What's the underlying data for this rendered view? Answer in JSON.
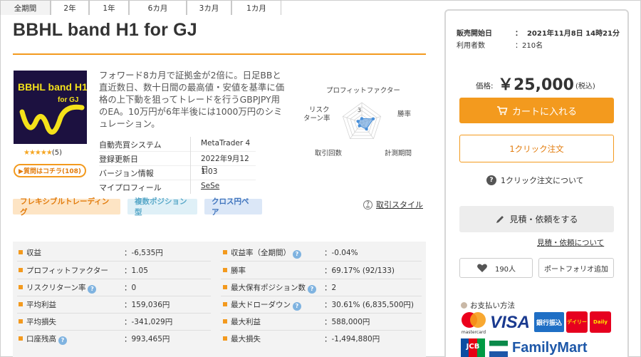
{
  "product": {
    "title": "BBHL band H1 for GJ",
    "logo_text_line1": "BBHL band H1",
    "logo_text_line2": "for GJ",
    "rating_stars": "★★★★★",
    "rating_count": "(5)",
    "rating_value": 5,
    "qa_button": "▶質問はコチラ(108)",
    "description": "フォワード8カ月で証拠金が2倍に。日足BBと直近数日、数十日間の最高値・安値を基準に価格の上下動を狙ってトレードを行うGBPJPY用のEA。10万円が6年半後には1000万円のシミュレーション。"
  },
  "specs": [
    {
      "label": "自動売買システム",
      "value": "MetaTrader 4"
    },
    {
      "label": "登録更新日",
      "value": "2022年9月12日"
    },
    {
      "label": "バージョン情報",
      "value": "1.03"
    },
    {
      "label": "マイプロフィール",
      "value": "SeSe"
    }
  ],
  "radar": {
    "axes": [
      "プロフィットファクター",
      "勝率",
      "計測期間",
      "取引回数",
      "リスク\nターン率"
    ],
    "axis_top": "プロフィットファクター",
    "axis_right": "勝率",
    "axis_bottom_right": "計測期間",
    "axis_bottom_left": "取引回数",
    "axis_left_line1": "リスク",
    "axis_left_line2": "ターン率",
    "scale_label": "3",
    "levels": [
      1,
      3,
      2,
      1,
      1
    ],
    "max": 5,
    "fill": "#4a90d9"
  },
  "tags": [
    "フレキシブルトレーディング",
    "複数ポジション型",
    "クロス円ペア"
  ],
  "trade_style_link": "取引スタイル",
  "tabs": [
    "全期間",
    "2年",
    "1年",
    "6カ月",
    "3カ月",
    "1カ月"
  ],
  "stats_left": [
    {
      "label": "収益",
      "value": "：-6,535円",
      "info": false
    },
    {
      "label": "プロフィットファクター",
      "value": "：1.05",
      "info": false
    },
    {
      "label": "リスクリターン率",
      "value": "：0",
      "info": true
    },
    {
      "label": "平均利益",
      "value": "：159,036円",
      "info": false
    },
    {
      "label": "平均損失",
      "value": "：-341,029円",
      "info": false
    },
    {
      "label": "口座残高",
      "value": "：993,465円",
      "info": true
    }
  ],
  "stats_right": [
    {
      "label": "収益率（全期間）",
      "value": "：-0.04%",
      "info": true
    },
    {
      "label": "勝率",
      "value": "：69.17% (92/133)",
      "info": false
    },
    {
      "label": "最大保有ポジション数",
      "value": "：2",
      "info": true
    },
    {
      "label": "最大ドローダウン",
      "value": "：30.61% (6,835,500円)",
      "info": true
    },
    {
      "label": "最大利益",
      "value": "：588,000円",
      "info": false
    },
    {
      "label": "最大損失",
      "value": "：-1,494,880円",
      "info": false
    }
  ],
  "sidebar": {
    "sale_start_label": "販売開始日",
    "sale_start_value": "：  2021年11月8日 14時21分",
    "users_label": "利用者数",
    "users_value": "：210名",
    "price_label": "価格:",
    "price_value": "￥25,000",
    "price_tax": "(税込)",
    "cart_button": "カートに入れる",
    "one_click_button": "1クリック注文",
    "one_click_help": "1クリック注文について",
    "quote_button": "見積・依頼をする",
    "quote_link": "見積・依頼について",
    "like_count": "190人",
    "portfolio_button": "ポートフォリオ追加",
    "payment_title": "お支払い方法",
    "pay_visa": "VISA",
    "pay_mastercard": "mastercard",
    "pay_bank": "銀行振込",
    "pay_daily1": "デイリー",
    "pay_daily2": "Daily",
    "pay_jcb": "JCB",
    "pay_familymart": "FamilyMart"
  },
  "colors": {
    "accent": "#f39a1e",
    "tag1_bg": "#fde4c4",
    "tag1_fg": "#e27b0b",
    "tag2_bg": "#dff0f7",
    "tag2_fg": "#5aa9c9",
    "tag3_bg": "#dbe7f7",
    "tag3_fg": "#3f74bd"
  }
}
